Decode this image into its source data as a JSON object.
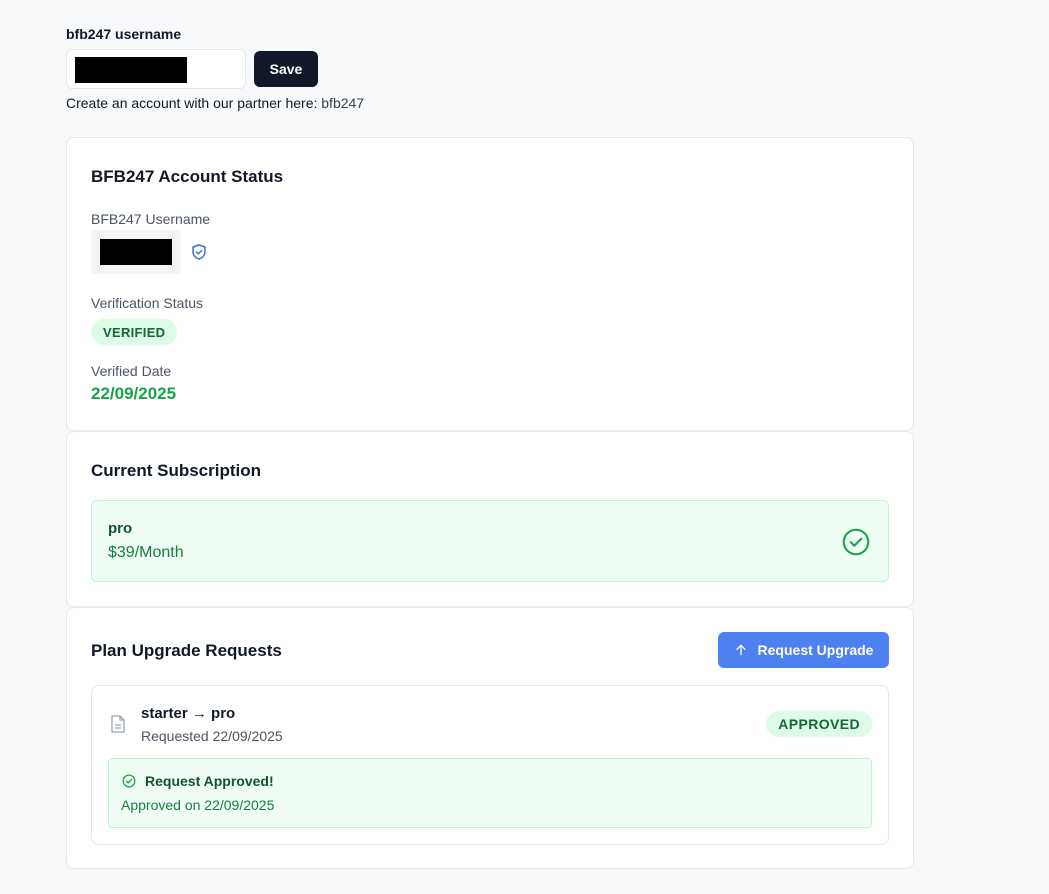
{
  "form": {
    "label": "bfb247 username",
    "save_label": "Save",
    "partner_text": "Create an account with our partner here: ",
    "partner_link": "bfb247"
  },
  "account_status": {
    "title": "BFB247 Account Status",
    "username_label": "BFB247 Username",
    "verification_label": "Verification Status",
    "verification_badge": "VERIFIED",
    "verified_date_label": "Verified Date",
    "verified_date": "22/09/2025"
  },
  "subscription": {
    "title": "Current Subscription",
    "plan_name": "pro",
    "plan_price": "$39/Month"
  },
  "upgrades": {
    "title": "Plan Upgrade Requests",
    "request_button": "Request Upgrade",
    "items": [
      {
        "title": "starter → pro",
        "requested": "Requested 22/09/2025",
        "status": "APPROVED",
        "approved_title": "Request Approved!",
        "approved_date": "Approved on 22/09/2025"
      }
    ]
  },
  "colors": {
    "primary_dark": "#111827",
    "accent_blue": "#4f80f0",
    "success": "#16a34a",
    "success_bg": "#f0fdf4"
  },
  "icons": [
    "shield-check-icon",
    "check-circle-icon",
    "arrow-up-icon",
    "document-icon"
  ]
}
